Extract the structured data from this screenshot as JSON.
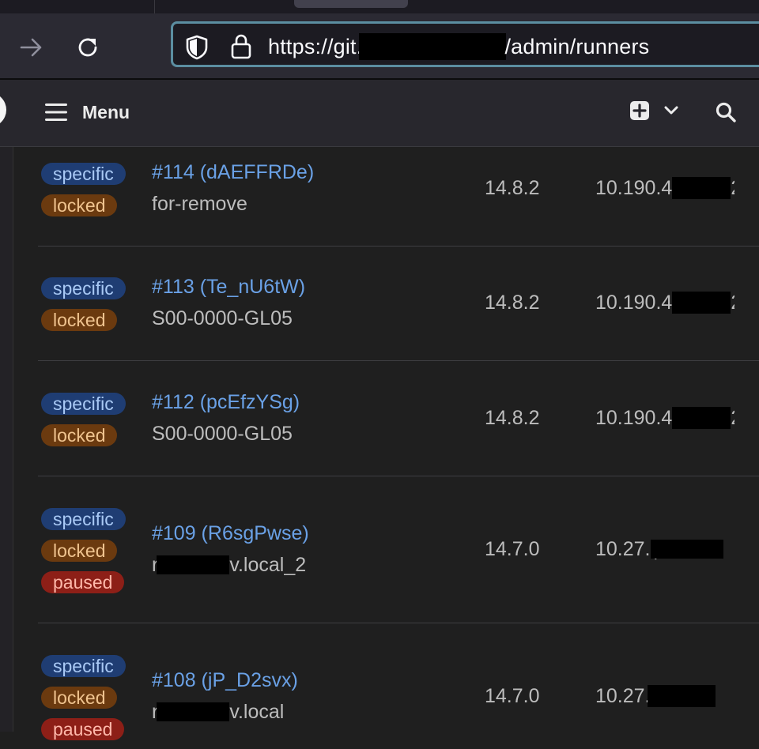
{
  "browser": {
    "url": "https://git.",
    "url_path": "/admin/runners"
  },
  "header": {
    "menu_label": "Menu",
    "icons": [
      "hamburger-icon",
      "plus-square-icon",
      "chevron-down-icon",
      "search-icon"
    ]
  },
  "runners": [
    {
      "id_label": "#114 (dAEFFRDe)",
      "description": "for-remove",
      "version": "14.8.2",
      "ip": "10.190.4",
      "ip_tail": "2",
      "badges": [
        "specific",
        "locked"
      ]
    },
    {
      "id_label": "#113 (Te_nU6tW)",
      "description": "S00-0000-GL05",
      "version": "14.8.2",
      "ip": "10.190.4",
      "ip_tail": "2",
      "badges": [
        "specific",
        "locked"
      ]
    },
    {
      "id_label": "#112 (pcEfzYSg)",
      "description": "S00-0000-GL05",
      "version": "14.8.2",
      "ip": "10.190.4",
      "ip_tail": "2",
      "badges": [
        "specific",
        "locked"
      ]
    },
    {
      "id_label": "#109 (R6sgPwse)",
      "description_prefix": "r",
      "description": "v.local_2",
      "version": "14.7.0",
      "ip": "10.27.(",
      "ip_tail": "",
      "badges": [
        "specific",
        "locked",
        "paused"
      ]
    },
    {
      "id_label": "#108 (jP_D2svx)",
      "description_prefix": "r",
      "description": "v.local",
      "version": "14.7.0",
      "ip": "10.27.",
      "ip_tail": "",
      "badges": [
        "specific",
        "locked",
        "paused"
      ]
    }
  ],
  "colors": {
    "link": "#6aa1e6",
    "badge_specific": "#1f3d73",
    "badge_locked": "#6b3a0f",
    "badge_paused": "#8d1f17"
  }
}
